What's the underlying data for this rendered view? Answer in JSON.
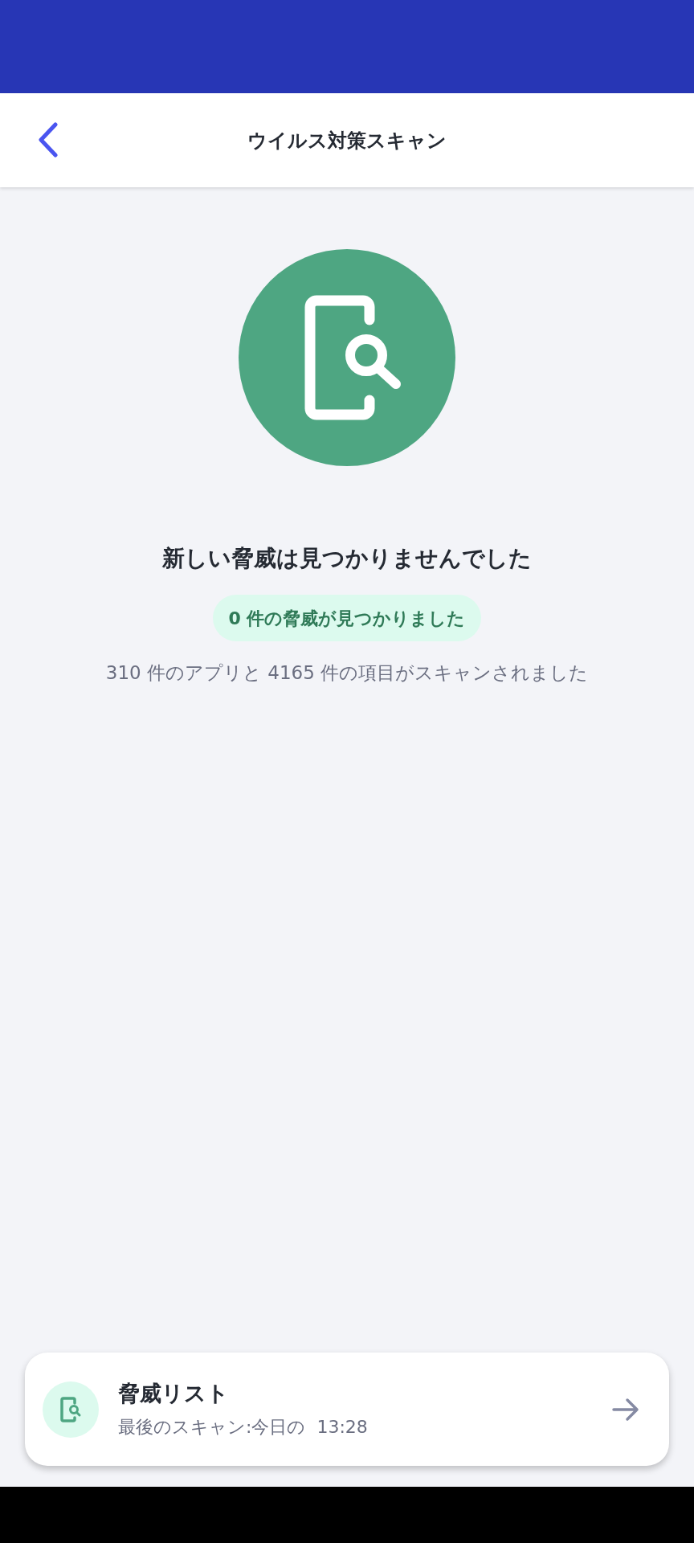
{
  "header": {
    "title": "ウイルス対策スキャン"
  },
  "result": {
    "title": "新しい脅威は見つかりませんでした",
    "badge": "0 件の脅威が見つかりました",
    "summary": "310 件のアプリと 4165 件の項目がスキャンされました"
  },
  "threat_list_card": {
    "title": "脅威リスト",
    "subtitle": "最後のスキャン:今日の  13:28"
  }
}
